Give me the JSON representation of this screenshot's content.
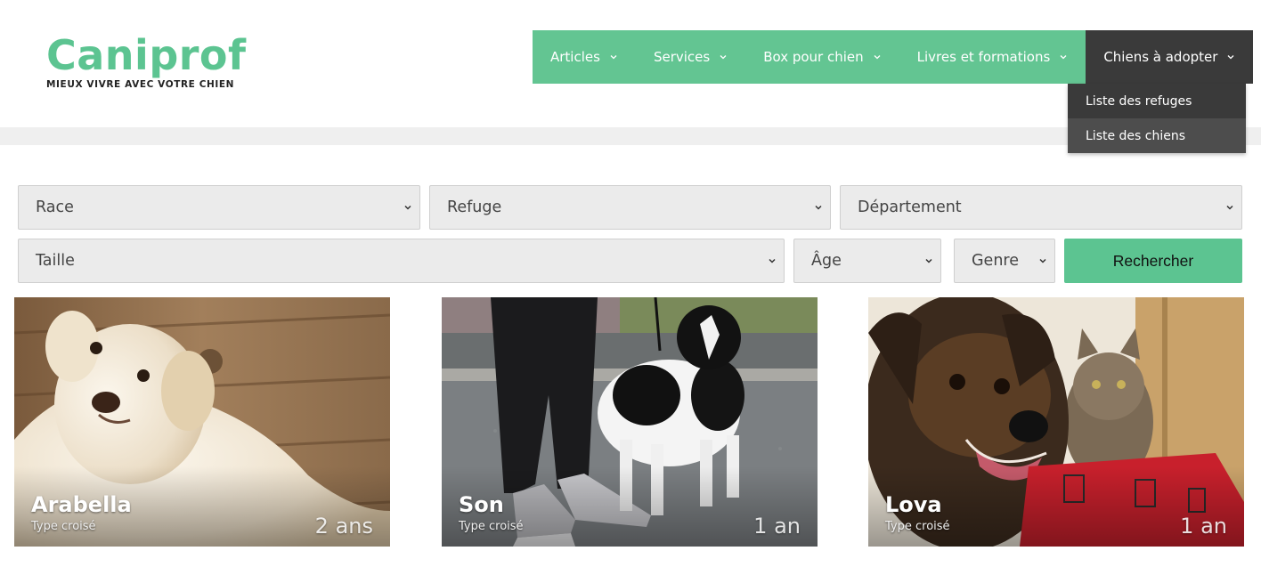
{
  "logo": {
    "title": "Caniprof",
    "tagline": "MIEUX VIVRE AVEC VOTRE CHIEN"
  },
  "nav": {
    "items": [
      {
        "label": "Articles",
        "icon": "chevron-down-icon"
      },
      {
        "label": "Services",
        "icon": "chevron-down-icon"
      },
      {
        "label": "Box pour chien",
        "icon": "chevron-down-icon"
      },
      {
        "label": "Livres et formations",
        "icon": "chevron-down-icon"
      },
      {
        "label": "Chiens à adopter",
        "icon": "chevron-down-icon",
        "active": true
      }
    ],
    "dropdown": [
      {
        "label": "Liste des refuges"
      },
      {
        "label": "Liste des chiens"
      }
    ]
  },
  "filters": {
    "race": "Race",
    "refuge": "Refuge",
    "departement": "Département",
    "taille": "Taille",
    "age": "Âge",
    "genre": "Genre",
    "search_label": "Rechercher"
  },
  "cards": [
    {
      "name": "Arabella",
      "type": "Type croisé",
      "age": "2 ans"
    },
    {
      "name": "Son",
      "type": "Type croisé",
      "age": "1 an"
    },
    {
      "name": "Lova",
      "type": "Type croisé",
      "age": "1 an"
    }
  ],
  "colors": {
    "brand_green": "#5cc491",
    "nav_green": "#63c592",
    "nav_active": "#3a3a3a"
  }
}
